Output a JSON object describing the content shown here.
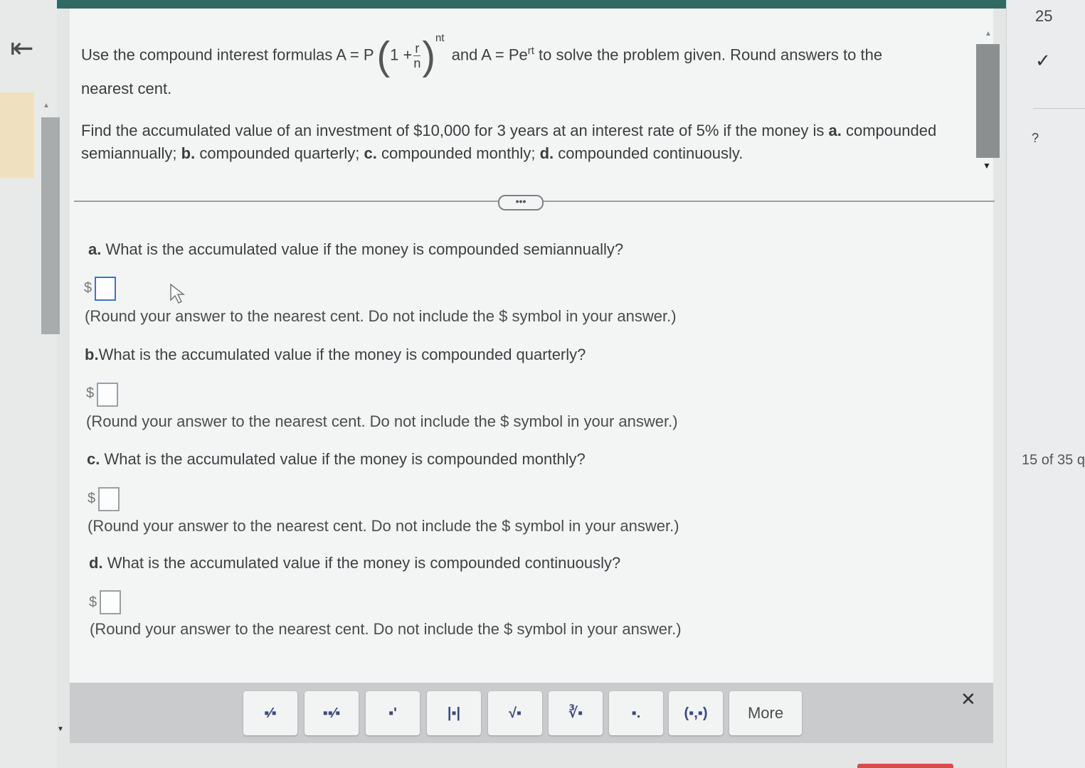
{
  "nav": {
    "back_icon": "back-to-start-icon",
    "back_glyph": "⇤"
  },
  "intro": {
    "prefix": "Use the compound interest formulas A = P",
    "one_plus": "1 +",
    "frac_num": "r",
    "frac_den": "n",
    "exp1": "nt",
    "middle": "and A = Pe",
    "exp2": "rt",
    "suffix": "to solve the problem given. Round answers to the",
    "line2": "nearest cent."
  },
  "problem": {
    "p1": "Find the accumulated value of an investment of $10,000 for 3 years at an interest rate of 5% if the money is",
    "a": "a.",
    "t_a": "compounded semiannually;",
    "b": "b.",
    "t_b": "compounded quarterly;",
    "c": "c.",
    "t_c": "compounded monthly;",
    "d": "d.",
    "t_d": "compounded continuously."
  },
  "expand_label": "•••",
  "parts": [
    {
      "label": "a.",
      "question": "What is the accumulated value if the money is compounded semiannually?",
      "currency": "$",
      "value": "",
      "hint": "(Round your answer to the nearest cent. Do not include the $ symbol in your answer.)"
    },
    {
      "label": "b.",
      "question": "What is the accumulated value if the money is compounded quarterly?",
      "currency": "$",
      "value": "",
      "hint": "(Round your answer to the nearest cent. Do not include the $ symbol in your answer.)"
    },
    {
      "label": "c.",
      "question": "What is the accumulated value if the money is compounded monthly?",
      "currency": "$",
      "value": "",
      "hint": "(Round your answer to the nearest cent. Do not include the $ symbol in your answer.)"
    },
    {
      "label": "d.",
      "question": "What is the accumulated value if the money is compounded continuously?",
      "currency": "$",
      "value": "",
      "hint": "(Round your answer to the nearest cent. Do not include the $ symbol in your answer.)"
    }
  ],
  "toolbar": {
    "tools": [
      {
        "icon": "fraction-icon",
        "glyph": "▪⁄▪"
      },
      {
        "icon": "mixed-number-icon",
        "glyph": "▪▪⁄▪"
      },
      {
        "icon": "exponent-icon",
        "glyph": "▪'"
      },
      {
        "icon": "absolute-value-icon",
        "glyph": "|▪|"
      },
      {
        "icon": "square-root-icon",
        "glyph": "√▪"
      },
      {
        "icon": "nth-root-icon",
        "glyph": "∛▪"
      },
      {
        "icon": "decimal-icon",
        "glyph": "▪."
      },
      {
        "icon": "ordered-pair-icon",
        "glyph": "(▪,▪)"
      }
    ],
    "more_label": "More",
    "close_glyph": "✕"
  },
  "right_panel": {
    "number": "25",
    "check_glyph": "✓",
    "question_glyph": "?",
    "count": "15 of 35 q"
  }
}
